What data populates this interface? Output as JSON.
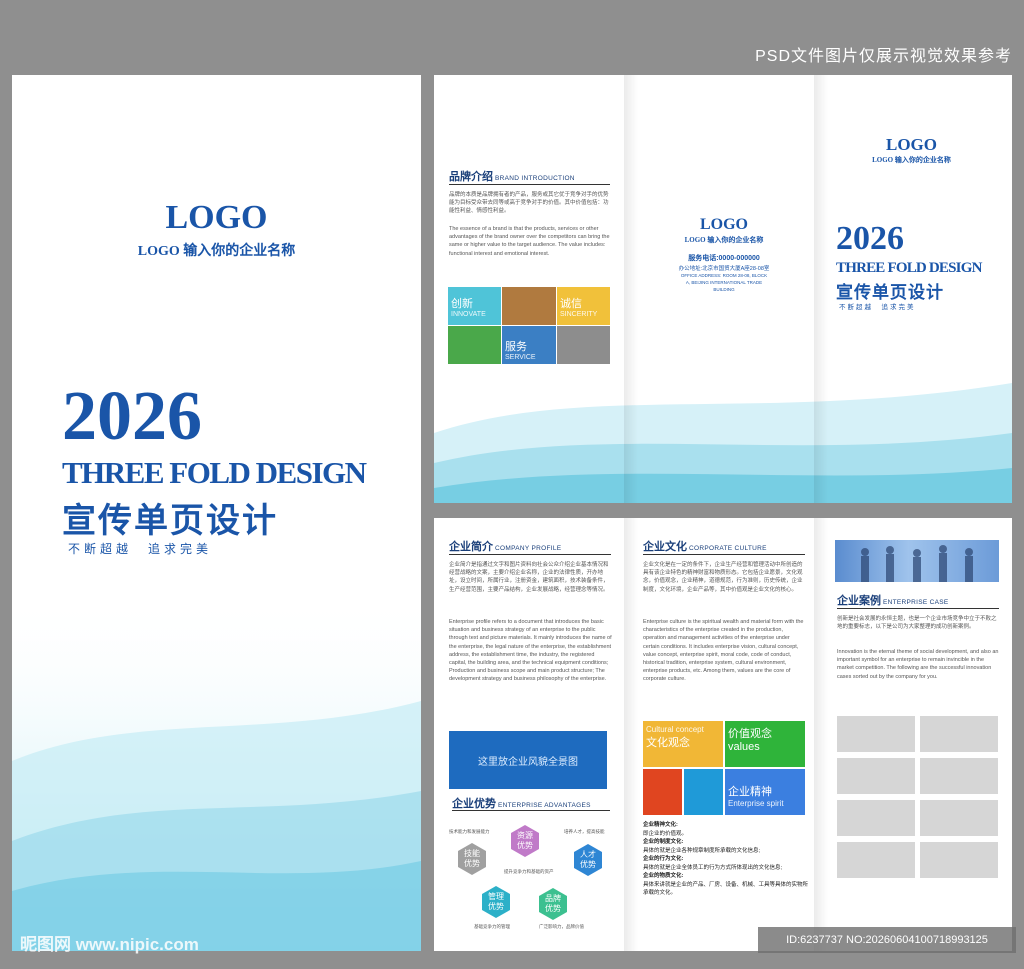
{
  "top_banner": "PSD文件图片仅展示视觉效果参考",
  "cover": {
    "logo": "LOGO",
    "logo_sub": "LOGO 输入你的企业名称",
    "year": "2026",
    "title_en": "THREE FOLD DESIGN",
    "title_cn": "宣传单页设计",
    "slogan": "不断超越　追求完美"
  },
  "outer": {
    "brand_heading": "品牌介绍",
    "brand_heading_en": "BRAND INTRODUCTION",
    "brand_text_cn": "品牌的本质是品牌拥有者的产品，服务或其它优于竞争对手的优势能为目标受众带去同等或高于竞争对手的价值。其中价值包括：功能性利益、情感性利益。",
    "brand_text_en": "The essence of a brand is that the products, services or other advantages of the brand owner over the competitors can bring the same or higher value to the target audience. The value includes: functional interest and emotional interest.",
    "tiles": [
      {
        "cn": "创新",
        "en": "INNOVATE",
        "color": "#4fc4d8"
      },
      {
        "cn": "",
        "en": "",
        "color": "#b07a3f"
      },
      {
        "cn": "诚信",
        "en": "SINCERITY",
        "color": "#f1c13a"
      },
      {
        "cn": "",
        "en": "",
        "color": "#4aa84a"
      },
      {
        "cn": "服务",
        "en": "SERVICE",
        "color": "#3b7fc4"
      },
      {
        "cn": "",
        "en": "",
        "color": "#8d8d8d"
      }
    ],
    "mid_logo": "LOGO",
    "mid_logo_sub": "LOGO 输入你的企业名称",
    "phone": "服务电话:0000-000000",
    "address_cn": "办公地址:北京市国贸大厦A座28-08室",
    "address_en": "OFFICE ADDRESS: ROOM 28-08, BLOCK A, BEIJING INTERNATIONAL TRADE BUILDING",
    "right_logo": "LOGO",
    "right_logo_sub": "LOGO 输入你的企业名称",
    "right_year": "2026",
    "right_title_en": "THREE FOLD DESIGN",
    "right_title_cn": "宣传单页设计",
    "right_slogan": "不断超越　追求完美"
  },
  "inner": {
    "profile_heading": "企业简介",
    "profile_heading_en": "COMPANY PROFILE",
    "profile_cn": "企业简介是指通过文字和图片资料向社会公众介绍企业基本情况和经营战略的文案，主要介绍企业名称，企业的法律性质，开办地址，设立时间，所属行业，注册资金，建筑面积，技术装备条件，生产经营范围，主要产品结构，企业发展战略，经营理念等情况。",
    "profile_en": "Enterprise profile refers to a document that introduces the basic situation and business strategy of an enterprise to the public through text and picture materials. It mainly introduces the name of the enterprise, the legal nature of the enterprise, the establishment address, the establishment time, the industry, the registered capital, the building area, and the technical equipment conditions; Production and business scope and main product structure; The development strategy and business philosophy of the enterprise.",
    "panorama": "这里放企业风貌全景图",
    "adv_heading": "企业优势",
    "adv_heading_en": "ENTERPRISE ADVANTAGES",
    "adv_captions": [
      "技术能力和发展能力",
      "培养人才，提高技能",
      "提升竞争力和基础的资产",
      "基础竞争力的管理",
      "广泛影响力，品牌价值"
    ],
    "hexes": [
      {
        "label": "技能优势",
        "color": "#a0a0a0"
      },
      {
        "label": "资源优势",
        "color": "#c07ac8"
      },
      {
        "label": "人才优势",
        "color": "#2e86d4"
      },
      {
        "label": "管理优势",
        "color": "#2cb0c8"
      },
      {
        "label": "品牌优势",
        "color": "#3cc090"
      }
    ],
    "culture_heading": "企业文化",
    "culture_heading_en": "CORPORATE CULTURE",
    "culture_cn": "企业文化是在一定的条件下，企业生产经营和管理活动中所创造的具有该企业特色的精神财富和物质形态。它包括企业愿景，文化观念，价值观念，企业精神，道德规范，行为准则，历史传统，企业制度，文化环境，企业产品等，其中价值观是企业文化的核心。",
    "culture_en": "Enterprise culture is the spiritual wealth and material form with the characteristics of the enterprise created in the production, operation and management activities of the enterprise under certain conditions. It includes enterprise vision, cultural concept, value concept, enterprise spirit, moral code, code of conduct, historical tradition, enterprise system, cultural environment, enterprise products, etc. Among them, values are the core of corporate culture.",
    "culture_tiles": [
      {
        "cn": "文化观念",
        "en": "Cultural concept",
        "color": "#f1b736"
      },
      {
        "cn": "价值观念",
        "en": "values",
        "color": "#2fb43a"
      },
      {
        "cn": "",
        "en": "",
        "color": "#e04520"
      },
      {
        "cn": "",
        "en": "",
        "color": "#1f9ad8"
      },
      {
        "cn": "企业精神",
        "en": "Enterprise spirit",
        "color": "#3b7fe0"
      }
    ],
    "culture_list": [
      {
        "t": "企业精神文化:",
        "d": "即企业的价值观。"
      },
      {
        "t": "企业的制度文化:",
        "d": "具体的就是企业各种规章制度所承载的文化信息;"
      },
      {
        "t": "企业的行为文化:",
        "d": "具体的就是企业全体员工的行为方式所体现出的文化信息;"
      },
      {
        "t": "企业的物质文化:",
        "d": "具体来讲就是企业的产品、厂房、设备、机械、工具等具体的实物所承载的文化。"
      }
    ],
    "case_heading": "企业案例",
    "case_heading_en": "ENTERPRISE CASE",
    "case_cn": "创新是社会发展的永恒主题，也是一个企业市场竞争中立于不败之地的重要标志，以下是公司为大家整理的成功创新案例。",
    "case_en": "Innovation is the eternal theme of social development, and also an important symbol for an enterprise to remain invincible in the market competition. The following are the successful innovation cases sorted out by the company for you."
  },
  "watermark_left": "昵图网 www.nipic.com",
  "watermark_right": "ID:6237737 NO:20260604100718993125"
}
